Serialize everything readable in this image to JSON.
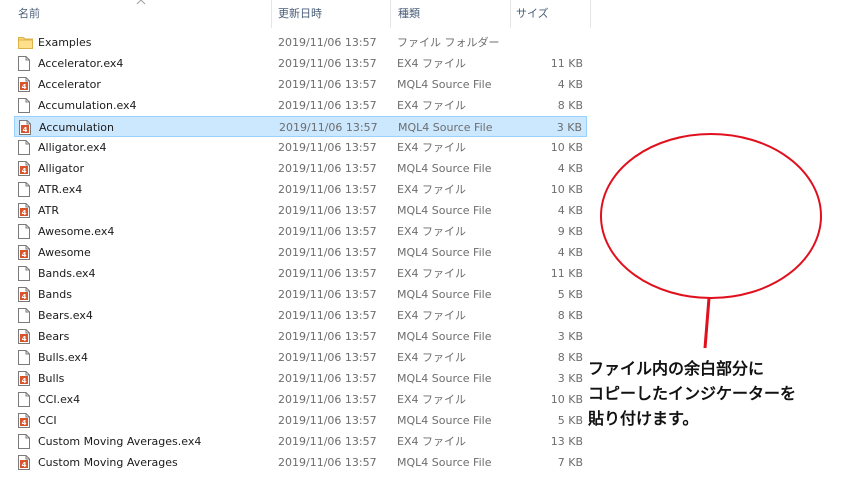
{
  "columns": {
    "name": "名前",
    "date": "更新日時",
    "type": "種類",
    "size": "サイズ"
  },
  "files": [
    {
      "name": "Examples",
      "date": "2019/11/06 13:57",
      "type": "ファイル フォルダー",
      "size": "",
      "icon": "folder-icon"
    },
    {
      "name": "Accelerator.ex4",
      "date": "2019/11/06 13:57",
      "type": "EX4 ファイル",
      "size": "11 KB",
      "icon": "file-icon"
    },
    {
      "name": "Accelerator",
      "date": "2019/11/06 13:57",
      "type": "MQL4 Source File",
      "size": "4 KB",
      "icon": "mql4-icon"
    },
    {
      "name": "Accumulation.ex4",
      "date": "2019/11/06 13:57",
      "type": "EX4 ファイル",
      "size": "8 KB",
      "icon": "file-icon"
    },
    {
      "name": "Accumulation",
      "date": "2019/11/06 13:57",
      "type": "MQL4 Source File",
      "size": "3 KB",
      "icon": "mql4-icon",
      "selected": true
    },
    {
      "name": "Alligator.ex4",
      "date": "2019/11/06 13:57",
      "type": "EX4 ファイル",
      "size": "10 KB",
      "icon": "file-icon"
    },
    {
      "name": "Alligator",
      "date": "2019/11/06 13:57",
      "type": "MQL4 Source File",
      "size": "4 KB",
      "icon": "mql4-icon"
    },
    {
      "name": "ATR.ex4",
      "date": "2019/11/06 13:57",
      "type": "EX4 ファイル",
      "size": "10 KB",
      "icon": "file-icon"
    },
    {
      "name": "ATR",
      "date": "2019/11/06 13:57",
      "type": "MQL4 Source File",
      "size": "4 KB",
      "icon": "mql4-icon"
    },
    {
      "name": "Awesome.ex4",
      "date": "2019/11/06 13:57",
      "type": "EX4 ファイル",
      "size": "9 KB",
      "icon": "file-icon"
    },
    {
      "name": "Awesome",
      "date": "2019/11/06 13:57",
      "type": "MQL4 Source File",
      "size": "4 KB",
      "icon": "mql4-icon"
    },
    {
      "name": "Bands.ex4",
      "date": "2019/11/06 13:57",
      "type": "EX4 ファイル",
      "size": "11 KB",
      "icon": "file-icon"
    },
    {
      "name": "Bands",
      "date": "2019/11/06 13:57",
      "type": "MQL4 Source File",
      "size": "5 KB",
      "icon": "mql4-icon"
    },
    {
      "name": "Bears.ex4",
      "date": "2019/11/06 13:57",
      "type": "EX4 ファイル",
      "size": "8 KB",
      "icon": "file-icon"
    },
    {
      "name": "Bears",
      "date": "2019/11/06 13:57",
      "type": "MQL4 Source File",
      "size": "3 KB",
      "icon": "mql4-icon"
    },
    {
      "name": "Bulls.ex4",
      "date": "2019/11/06 13:57",
      "type": "EX4 ファイル",
      "size": "8 KB",
      "icon": "file-icon"
    },
    {
      "name": "Bulls",
      "date": "2019/11/06 13:57",
      "type": "MQL4 Source File",
      "size": "3 KB",
      "icon": "mql4-icon"
    },
    {
      "name": "CCI.ex4",
      "date": "2019/11/06 13:57",
      "type": "EX4 ファイル",
      "size": "10 KB",
      "icon": "file-icon"
    },
    {
      "name": "CCI",
      "date": "2019/11/06 13:57",
      "type": "MQL4 Source File",
      "size": "5 KB",
      "icon": "mql4-icon"
    },
    {
      "name": "Custom Moving Averages.ex4",
      "date": "2019/11/06 13:57",
      "type": "EX4 ファイル",
      "size": "13 KB",
      "icon": "file-icon"
    },
    {
      "name": "Custom Moving Averages",
      "date": "2019/11/06 13:57",
      "type": "MQL4 Source File",
      "size": "7 KB",
      "icon": "mql4-icon"
    }
  ],
  "annotation": {
    "lines": [
      "ファイル内の余白部分に",
      "コピーしたインジケーターを",
      "貼り付けます。"
    ],
    "color": "#e0101e"
  }
}
